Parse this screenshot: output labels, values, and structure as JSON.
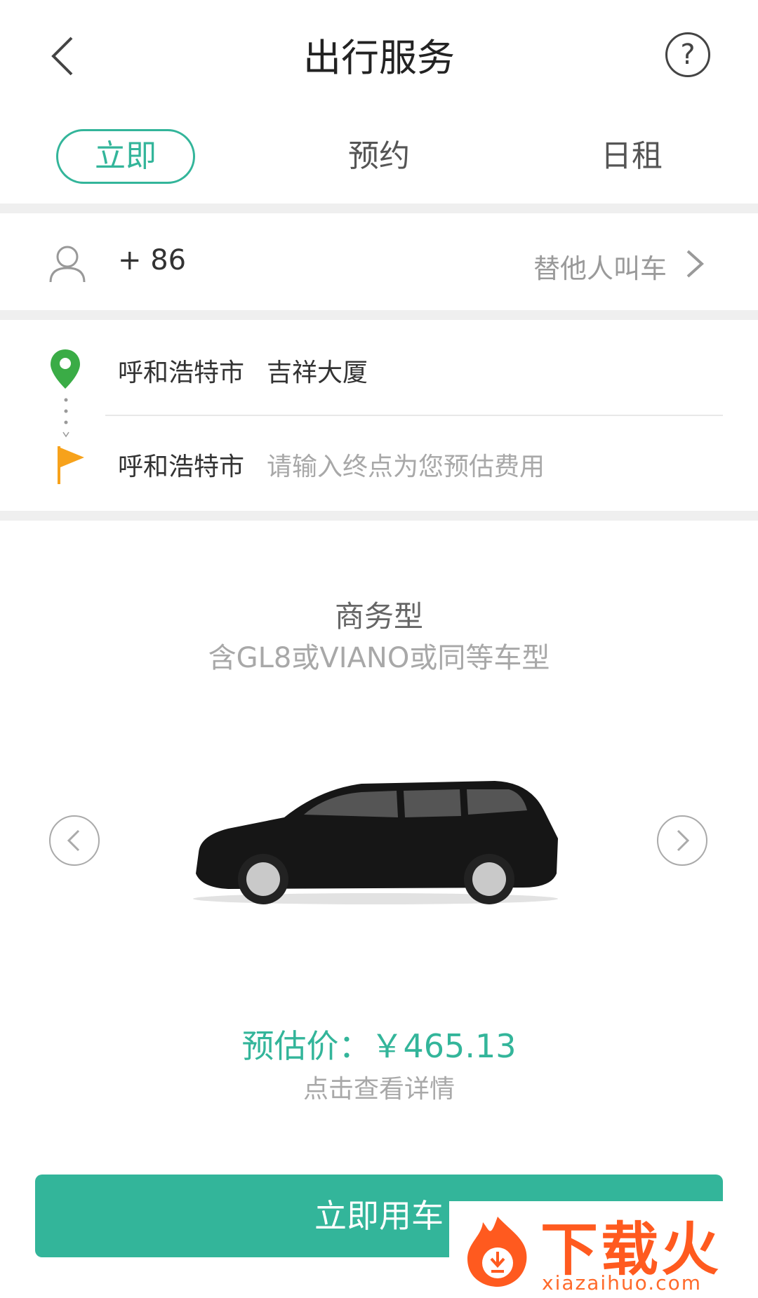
{
  "header": {
    "title": "出行服务",
    "help_glyph": "?"
  },
  "tabs": [
    {
      "label": "立即",
      "active": true
    },
    {
      "label": "预约",
      "active": false
    },
    {
      "label": "日租",
      "active": false
    }
  ],
  "passenger": {
    "phone_code": "+ 86",
    "other_call_label": "替他人叫车"
  },
  "route": {
    "from_city": "呼和浩特市",
    "from_place": "吉祥大厦",
    "to_city": "呼和浩特市",
    "to_placeholder": "请输入终点为您预估费用"
  },
  "car": {
    "type": "商务型",
    "description": "含GL8或VIANO或同等车型"
  },
  "estimate": {
    "price_label": "预估价：￥465.13",
    "detail_link": "点击查看详情"
  },
  "action": {
    "book_label": "立即用车"
  },
  "watermark": {
    "brand": "下载火",
    "url": "xiazaihuo.com"
  },
  "colors": {
    "accent": "#33b59a",
    "pin": "#3aac46",
    "flag": "#f7a21b",
    "watermark": "#ff5a1f"
  }
}
